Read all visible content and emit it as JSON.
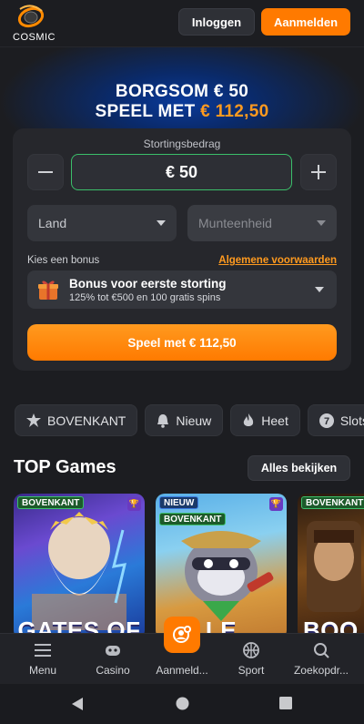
{
  "header": {
    "logo_text": "COSMIC",
    "login_label": "Inloggen",
    "signup_label": "Aanmelden"
  },
  "hero": {
    "line1": "BORGSOM € 50",
    "line2_prefix": "SPEEL MET",
    "line2_amount": "€ 112,50"
  },
  "deposit": {
    "label": "Stortingsbedrag",
    "amount": "€ 50",
    "minus_label": "—",
    "plus_label": "+",
    "country_placeholder": "Land",
    "currency_placeholder": "Munteenheid"
  },
  "bonus": {
    "label": "Kies een bonus",
    "terms_link": "Algemene voorwaarden",
    "title": "Bonus voor eerste storting",
    "subtitle": "125% tot €500 en 100 gratis spins"
  },
  "play_button": "Speel met € 112,50",
  "chips": [
    {
      "label": "BOVENKANT",
      "icon": "star-burst-icon"
    },
    {
      "label": "Nieuw",
      "icon": "bell-icon"
    },
    {
      "label": "Heet",
      "icon": "flame-icon"
    },
    {
      "label": "Slots",
      "icon": "seven-icon"
    }
  ],
  "top_games": {
    "title": "TOP Games",
    "see_all": "Alles bekijken",
    "games": [
      {
        "tags": [
          "BOVENKANT"
        ],
        "title": "GATES OF"
      },
      {
        "tags": [
          "NIEUW",
          "BOVENKANT"
        ],
        "title": "LE"
      },
      {
        "tags": [
          "BOVENKANT"
        ],
        "title": "BOO"
      }
    ]
  },
  "bottom_nav": [
    {
      "label": "Menu",
      "icon": "hamburger-icon"
    },
    {
      "label": "Casino",
      "icon": "gamepad-icon"
    },
    {
      "label": "Aanmeld...",
      "icon": "user-plus-icon"
    },
    {
      "label": "Sport",
      "icon": "ball-icon"
    },
    {
      "label": "Zoekopdr...",
      "icon": "search-icon"
    }
  ],
  "colors": {
    "accent": "#ff7a00",
    "accent_light": "#ff9a1f",
    "background": "#1c1d21",
    "card": "#26272c",
    "success_border": "#3bbf6a"
  }
}
